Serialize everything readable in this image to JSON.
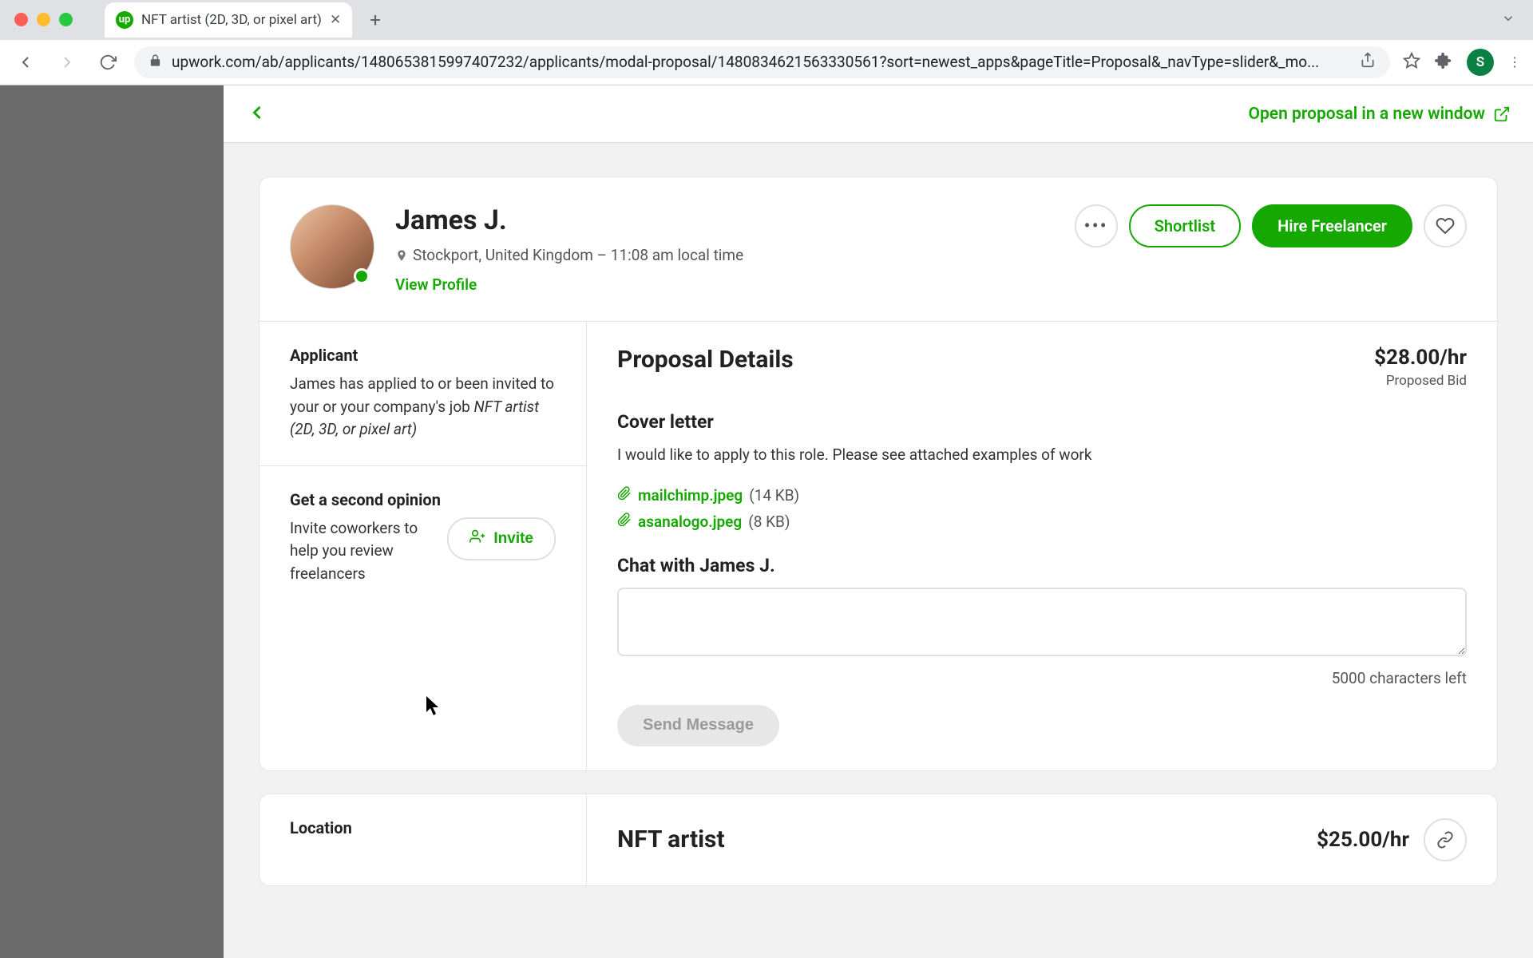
{
  "browser": {
    "tab_title": "NFT artist (2D, 3D, or pixel art)",
    "url": "upwork.com/ab/applicants/1480653815997407232/applicants/modal-proposal/1480834621563330561?sort=newest_apps&pageTitle=Proposal&_navType=slider&_mo...",
    "profile_initial": "S"
  },
  "panel": {
    "open_new_window": "Open proposal in a new window"
  },
  "profile": {
    "name": "James J.",
    "location": "Stockport, United Kingdom – 11:08 am local time",
    "view_profile": "View Profile"
  },
  "actions": {
    "shortlist": "Shortlist",
    "hire": "Hire Freelancer"
  },
  "applicant": {
    "title": "Applicant",
    "desc_prefix": "James has applied to or been invited to your or your company's job ",
    "job_title": "NFT artist (2D, 3D, or pixel art)"
  },
  "opinion": {
    "title": "Get a second opinion",
    "desc": "Invite coworkers to help you review freelancers",
    "button": "Invite"
  },
  "proposal": {
    "heading": "Proposal Details",
    "bid_amount": "$28.00/hr",
    "bid_label": "Proposed Bid",
    "cover_heading": "Cover letter",
    "cover_text": "I would like to apply to this role. Please see attached examples of work",
    "attachments": [
      {
        "name": "mailchimp.jpeg",
        "size": "(14 KB)"
      },
      {
        "name": "asanalogo.jpeg",
        "size": "(8 KB)"
      }
    ],
    "chat_heading": "Chat with James J.",
    "char_left": "5000 characters left",
    "send": "Send Message"
  },
  "bottom": {
    "location_title": "Location",
    "role_title": "NFT artist",
    "rate": "$25.00/hr"
  }
}
